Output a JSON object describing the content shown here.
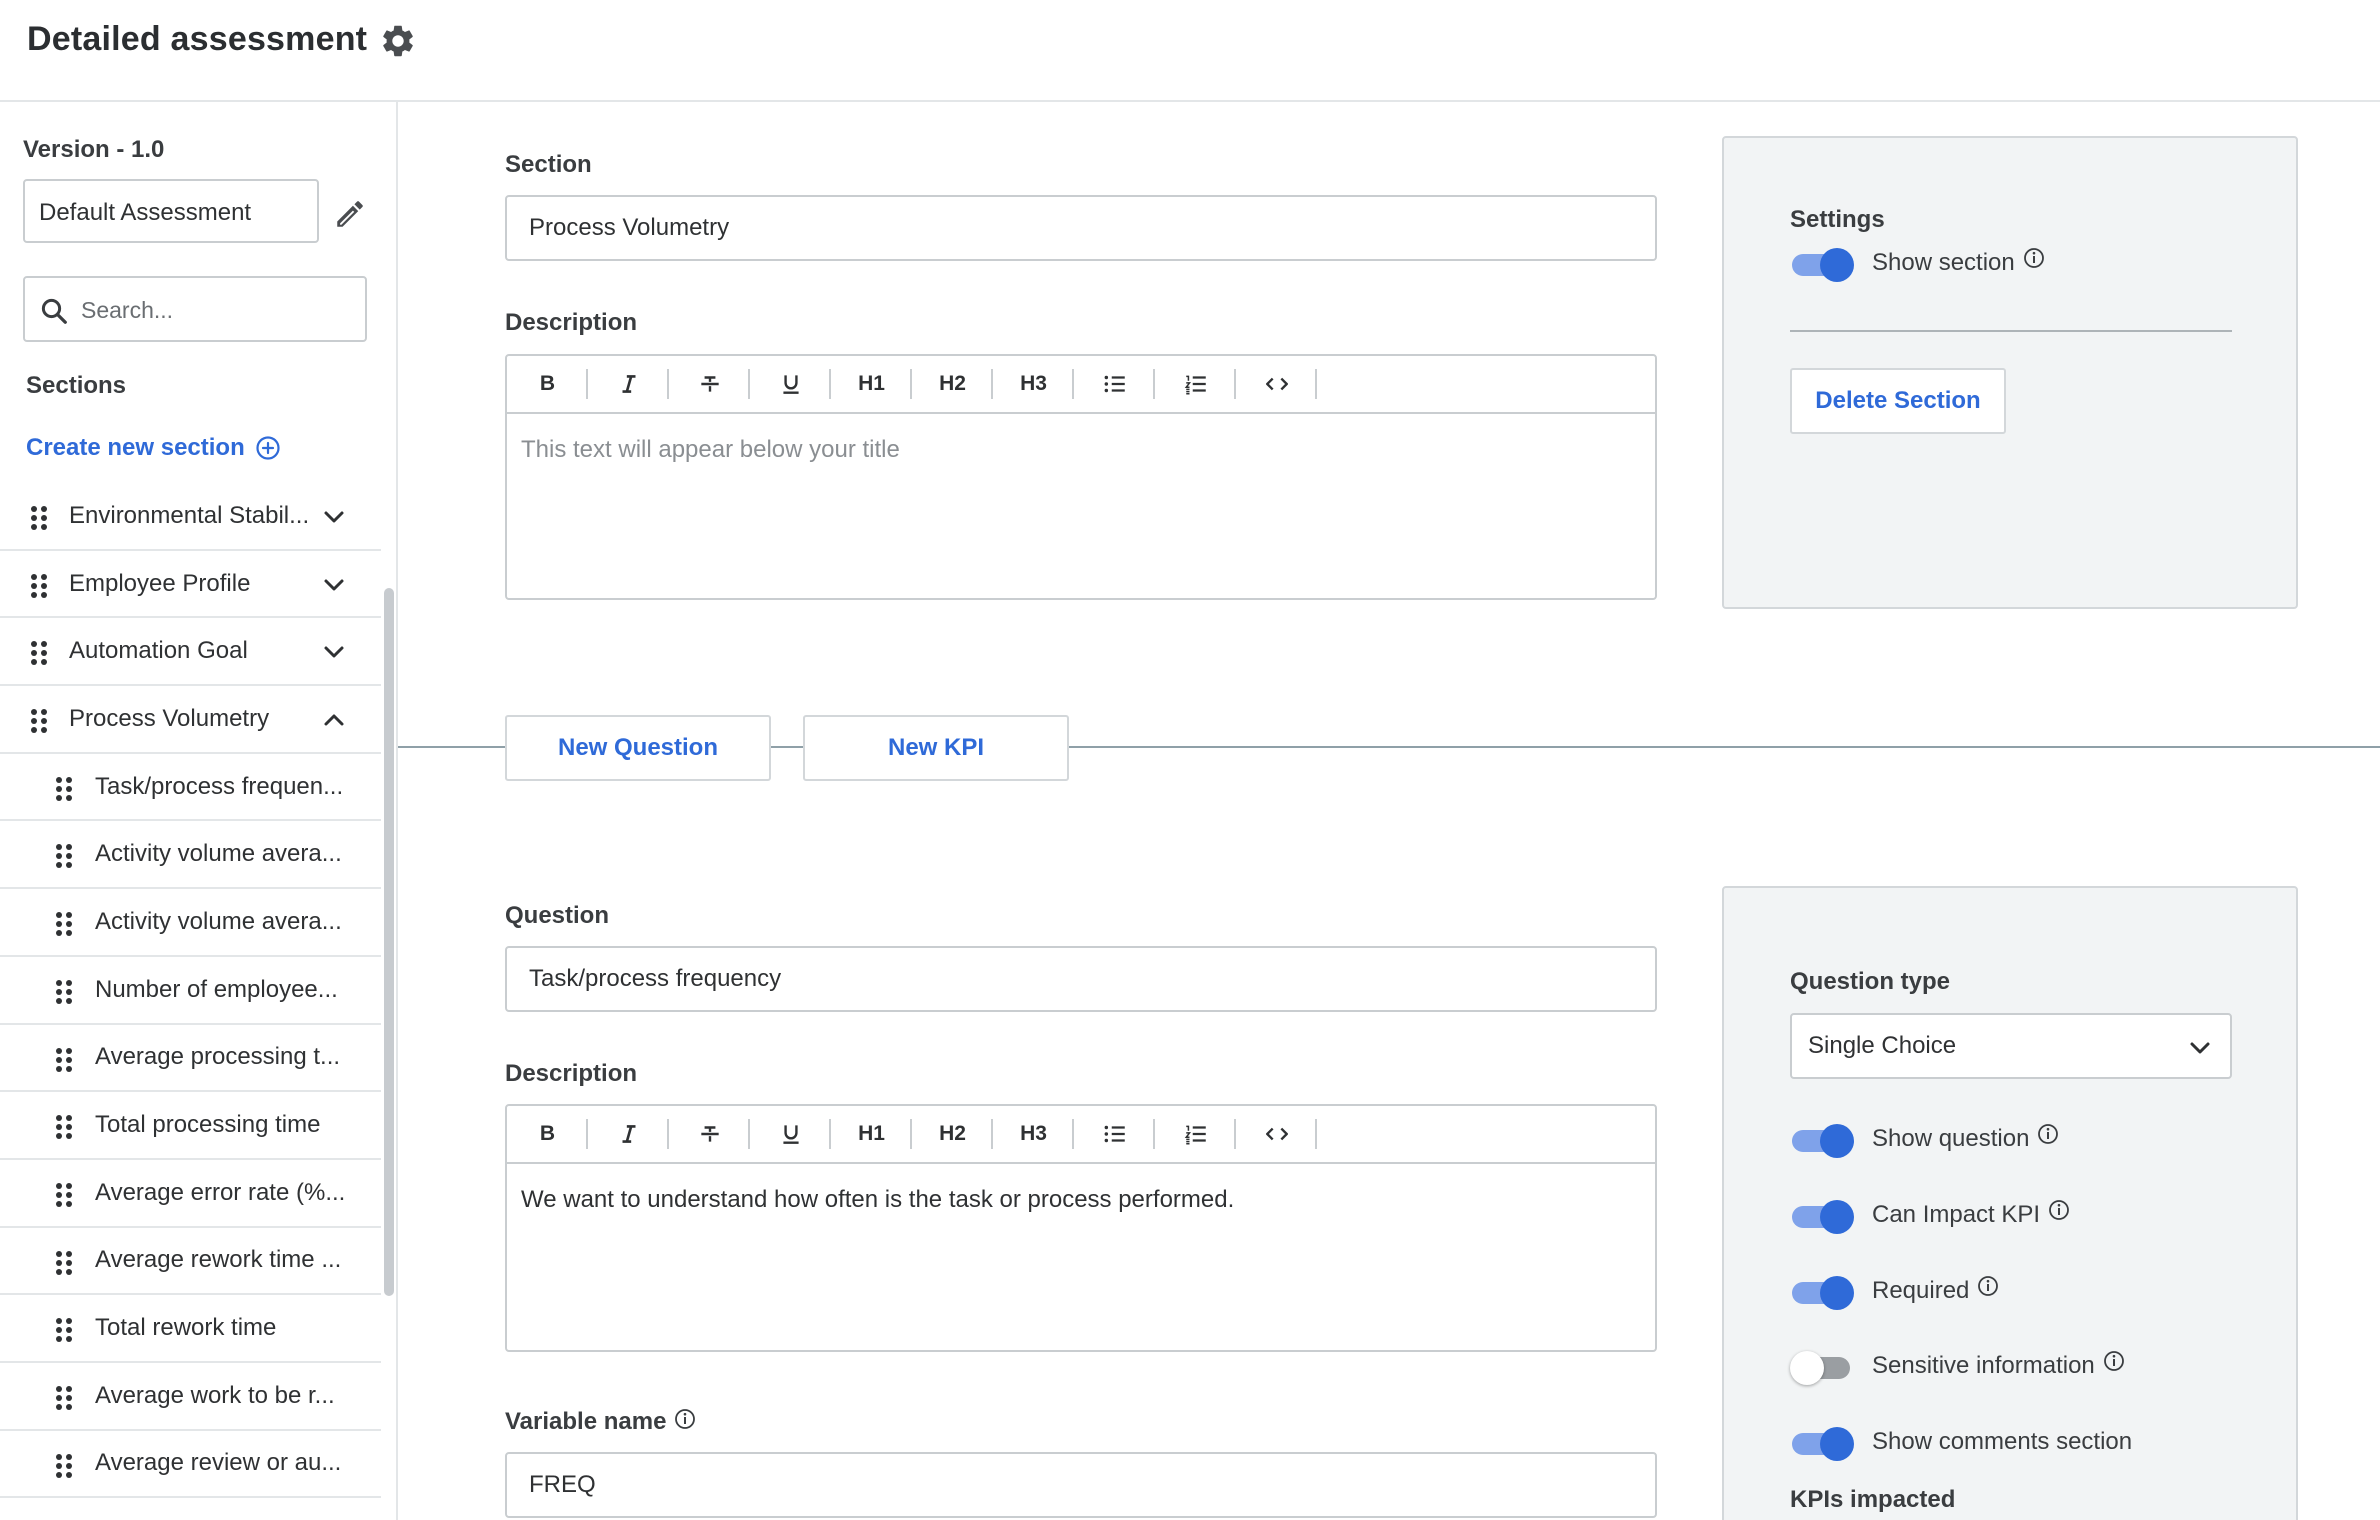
{
  "header": {
    "title": "Detailed assessment",
    "settings_icon": "gear-icon"
  },
  "sidebar": {
    "version": "Version - 1.0",
    "assessment_name": "Default Assessment",
    "search_placeholder": "Search...",
    "sections_label": "Sections",
    "create_section": "Create new section",
    "items": [
      {
        "label": "Environmental Stabil...",
        "expanded": false
      },
      {
        "label": "Employee Profile",
        "expanded": false
      },
      {
        "label": "Automation Goal",
        "expanded": false
      },
      {
        "label": "Process Volumetry",
        "expanded": true
      }
    ],
    "subitems": [
      "Task/process frequen...",
      "Activity volume avera...",
      "Activity volume avera...",
      "Number of employee...",
      "Average processing t...",
      "Total processing time",
      "Average error rate (%...",
      "Average rework time ...",
      "Total rework time",
      "Average work to be r...",
      "Average review or au..."
    ]
  },
  "section_form": {
    "section_label": "Section",
    "section_value": "Process Volumetry",
    "description_label": "Description",
    "description_placeholder": "This text will appear below your title"
  },
  "toolbar": {
    "bold": "B",
    "h1": "H1",
    "h2": "H2",
    "h3": "H3"
  },
  "section_settings": {
    "title": "Settings",
    "show_section": "Show section",
    "show_section_on": true,
    "delete_button": "Delete Section"
  },
  "actions": {
    "new_question": "New Question",
    "new_kpi": "New KPI"
  },
  "question_form": {
    "question_label": "Question",
    "question_value": "Task/process frequency",
    "description_label": "Description",
    "description_value": "We want to understand how often is the task or process performed.",
    "variable_label": "Variable name",
    "variable_value": "FREQ"
  },
  "question_settings": {
    "type_label": "Question type",
    "type_value": "Single Choice",
    "show_question": "Show question",
    "show_question_on": true,
    "can_impact_kpi": "Can Impact KPI",
    "can_impact_kpi_on": true,
    "required": "Required",
    "required_on": true,
    "sensitive_info": "Sensitive information",
    "sensitive_info_on": false,
    "show_comments": "Show comments section",
    "show_comments_on": true,
    "kpis_impacted": "KPIs impacted"
  },
  "colors": {
    "accent": "#2f6ad8",
    "toggle_track": "#7fa2ea",
    "panel_bg": "#f2f4f5"
  }
}
